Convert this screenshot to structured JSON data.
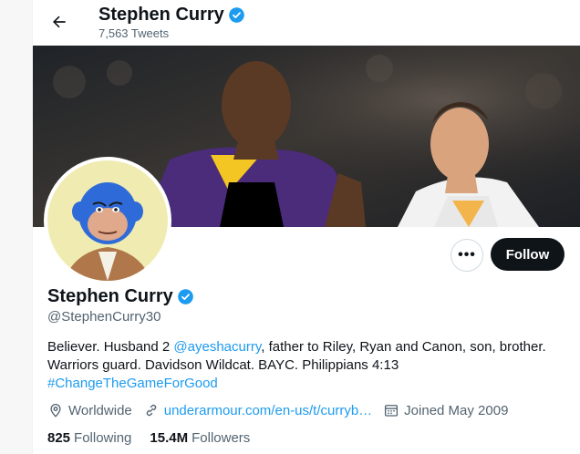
{
  "header": {
    "name": "Stephen Curry",
    "tweet_count": "7,563 Tweets"
  },
  "profile": {
    "name": "Stephen Curry",
    "handle": "@StephenCurry30",
    "bio": {
      "part1": "Believer. Husband 2 ",
      "mention": "@ayeshacurry",
      "part2": ", father to Riley, Ryan and Canon, son, brother.",
      "line2": "Warriors guard. Davidson Wildcat. BAYC. Philippians 4:13",
      "hashtag": "#ChangeTheGameForGood"
    },
    "location": "Worldwide",
    "website": "underarmour.com/en-us/t/curryb…",
    "joined": "Joined May 2009",
    "following_count": "825",
    "following_label": "Following",
    "followers_count": "15.4M",
    "followers_label": "Followers"
  },
  "actions": {
    "more_label": "•••",
    "follow_label": "Follow"
  },
  "icons": [
    "back-arrow-icon",
    "verified-badge-icon",
    "location-pin-icon",
    "link-icon",
    "calendar-icon"
  ],
  "colors": {
    "verified": "#1d9bf0",
    "link": "#1d9bf0",
    "follow_button": "#0f1419",
    "secondary_text": "#536471"
  }
}
